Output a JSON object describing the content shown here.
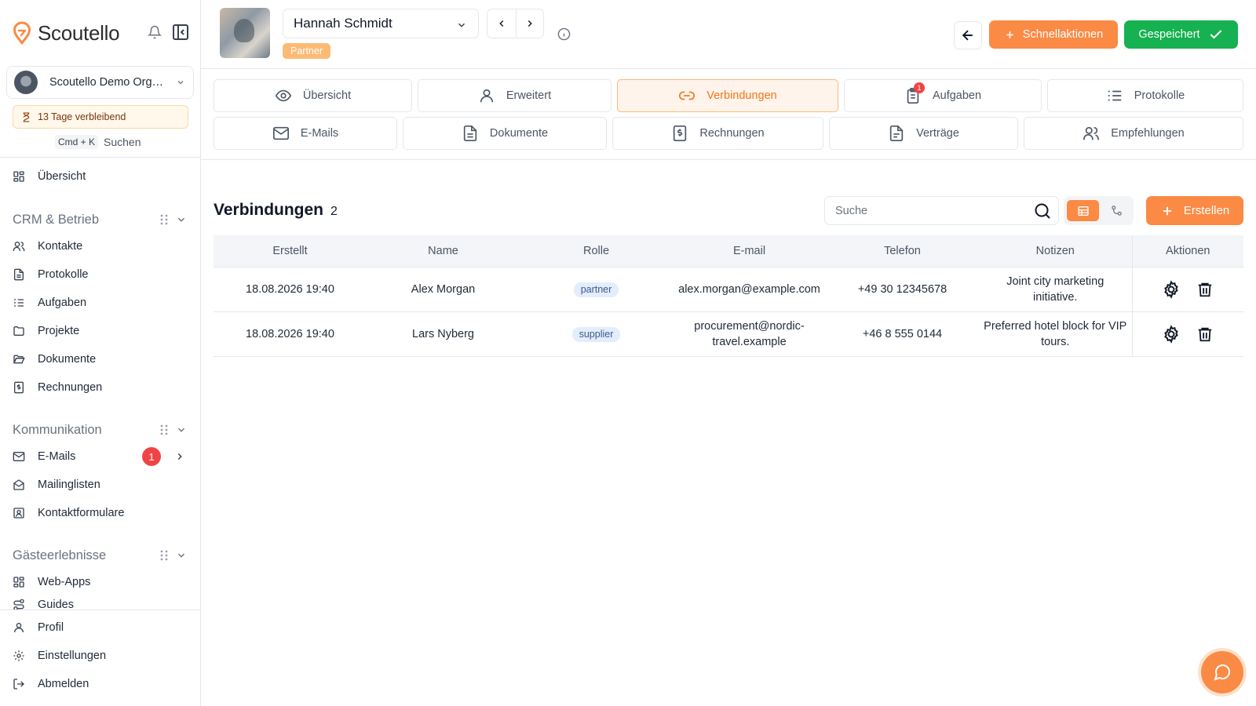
{
  "app": {
    "name": "Scoutello",
    "accent": "#fb8a45",
    "success": "#16b150"
  },
  "sidebar": {
    "org_name": "Scoutello Demo Org…",
    "trial": "13 Tage verbleibend",
    "search_kbd": "Cmd + K",
    "search_label": "Suchen",
    "overview": "Übersicht",
    "sections": [
      {
        "title": "CRM & Betrieb",
        "items": [
          "Kontakte",
          "Protokolle",
          "Aufgaben",
          "Projekte",
          "Dokumente",
          "Rechnungen"
        ]
      },
      {
        "title": "Kommunikation",
        "items": [
          "E-Mails",
          "Mailinglisten",
          "Kontaktformulare"
        ],
        "email_badge": "1"
      },
      {
        "title": "Gästeerlebnisse",
        "items": [
          "Web-Apps",
          "Guides"
        ]
      }
    ],
    "bottom": [
      "Profil",
      "Einstellungen",
      "Abmelden"
    ]
  },
  "header": {
    "contact_name": "Hannah Schmidt",
    "role": "Partner",
    "quick_actions": "Schnellaktionen",
    "saved": "Gespeichert"
  },
  "tabs": {
    "row1": [
      "Übersicht",
      "Erweitert",
      "Verbindungen",
      "Aufgaben",
      "Protokolle"
    ],
    "row2": [
      "E-Mails",
      "Dokumente",
      "Rechnungen",
      "Verträge",
      "Empfehlungen"
    ],
    "tasks_badge": "1",
    "active": "Verbindungen"
  },
  "connections": {
    "title": "Verbindungen",
    "count": "2",
    "search_placeholder": "Suche",
    "create_label": "Erstellen",
    "columns": [
      "Erstellt",
      "Name",
      "Rolle",
      "E-mail",
      "Telefon",
      "Notizen",
      "Aktionen"
    ],
    "rows": [
      {
        "created": "18.08.2026 19:40",
        "name": "Alex Morgan",
        "role": "partner",
        "email": "alex.morgan@example.com",
        "phone": "+49 30 12345678",
        "notes": "Joint city marketing initiative."
      },
      {
        "created": "18.08.2026 19:40",
        "name": "Lars Nyberg",
        "role": "supplier",
        "email": "procurement@nordic-travel.example",
        "phone": "+46 8 555 0144",
        "notes": "Preferred hotel block for VIP tours."
      }
    ]
  }
}
